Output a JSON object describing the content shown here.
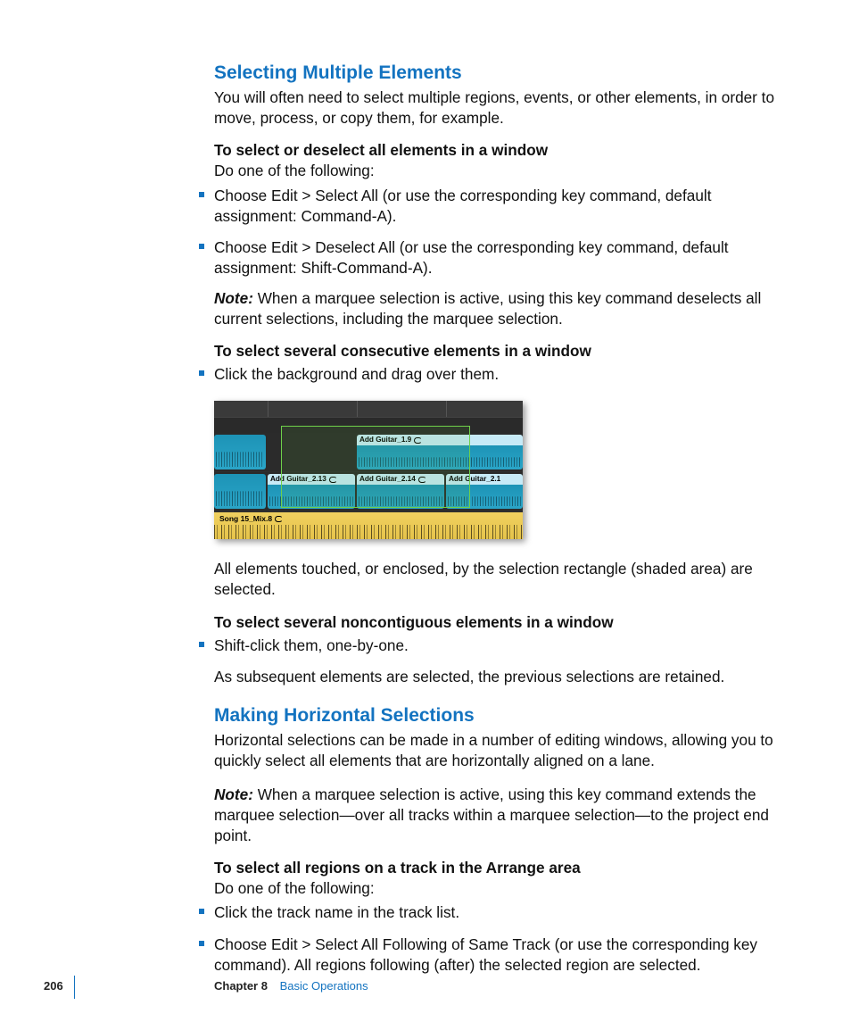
{
  "section1": {
    "heading": "Selecting Multiple Elements",
    "intro": "You will often need to select multiple regions, events, or other elements, in order to move, process, or copy them, for example.",
    "task1_title": "To select or deselect all elements in a window",
    "task1_sub": "Do one of the following:",
    "task1_items": [
      "Choose Edit > Select All (or use the corresponding key command, default assignment:  Command-A).",
      "Choose Edit > Deselect All (or use the corresponding key command, default assignment:  Shift-Command-A)."
    ],
    "note1_label": "Note:",
    "note1_body": "  When a marquee selection is active, using this key command deselects all current selections, including the marquee selection.",
    "task2_title": "To select several consecutive elements in a window",
    "task2_items": [
      "Click the background and drag over them."
    ],
    "after_fig": "All elements touched, or enclosed, by the selection rectangle (shaded area) are selected.",
    "task3_title": "To select several noncontiguous elements in a window",
    "task3_items": [
      "Shift-click them, one-by-one."
    ],
    "task3_after": "As subsequent elements are selected, the previous selections are retained."
  },
  "section2": {
    "heading": "Making Horizontal Selections",
    "intro": "Horizontal selections can be made in a number of editing windows, allowing you to quickly select all elements that are horizontally aligned on a lane.",
    "note_label": "Note:",
    "note_body": "  When a marquee selection is active, using this key command extends the marquee selection—over all tracks within a marquee selection—to the project end point.",
    "task1_title": "To select all regions on a track in the Arrange area",
    "task1_sub": "Do one of the following:",
    "task1_items": [
      "Click the track name in the track list.",
      "Choose Edit > Select All Following of Same Track (or use the corresponding key command). All regions following (after) the selected region are selected."
    ]
  },
  "figure": {
    "regions": {
      "r1": "Add Guitar_1.9",
      "r2": "Add Guitar_2.13",
      "r3": "Add Guitar_2.14",
      "r4": "Add Guitar_2.1"
    },
    "mix_label": "Song 15_Mix.8"
  },
  "footer": {
    "page": "206",
    "chapter": "Chapter 8",
    "title": "Basic Operations"
  }
}
